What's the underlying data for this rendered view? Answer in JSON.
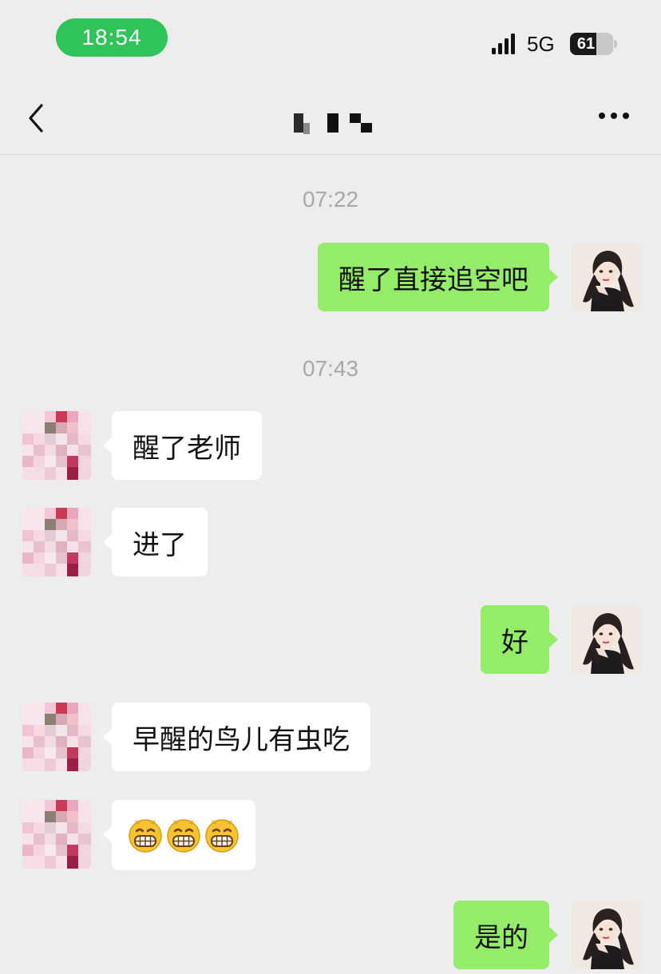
{
  "status_bar": {
    "time": "18:54",
    "network": "5G",
    "battery": 61
  },
  "header": {
    "back_icon": "chevron-left-icon",
    "more_icon": "ellipsis-icon"
  },
  "colors": {
    "sent_bubble": "#95ec69",
    "recv_bubble": "#ffffff",
    "background": "#ededed",
    "time_pill": "#30c35a"
  },
  "chat": {
    "time_1": "07:22",
    "time_2": "07:43",
    "messages": [
      {
        "from": "me",
        "text": "醒了直接追空吧"
      },
      {
        "from": "other",
        "text": "醒了老师"
      },
      {
        "from": "other",
        "text": "进了"
      },
      {
        "from": "me",
        "text": "好"
      },
      {
        "from": "other",
        "text": "早醒的鸟儿有虫吃"
      },
      {
        "from": "other",
        "emoji": [
          "grinning-face",
          "grinning-face",
          "grinning-face"
        ]
      },
      {
        "from": "me",
        "text": "是的"
      }
    ]
  }
}
